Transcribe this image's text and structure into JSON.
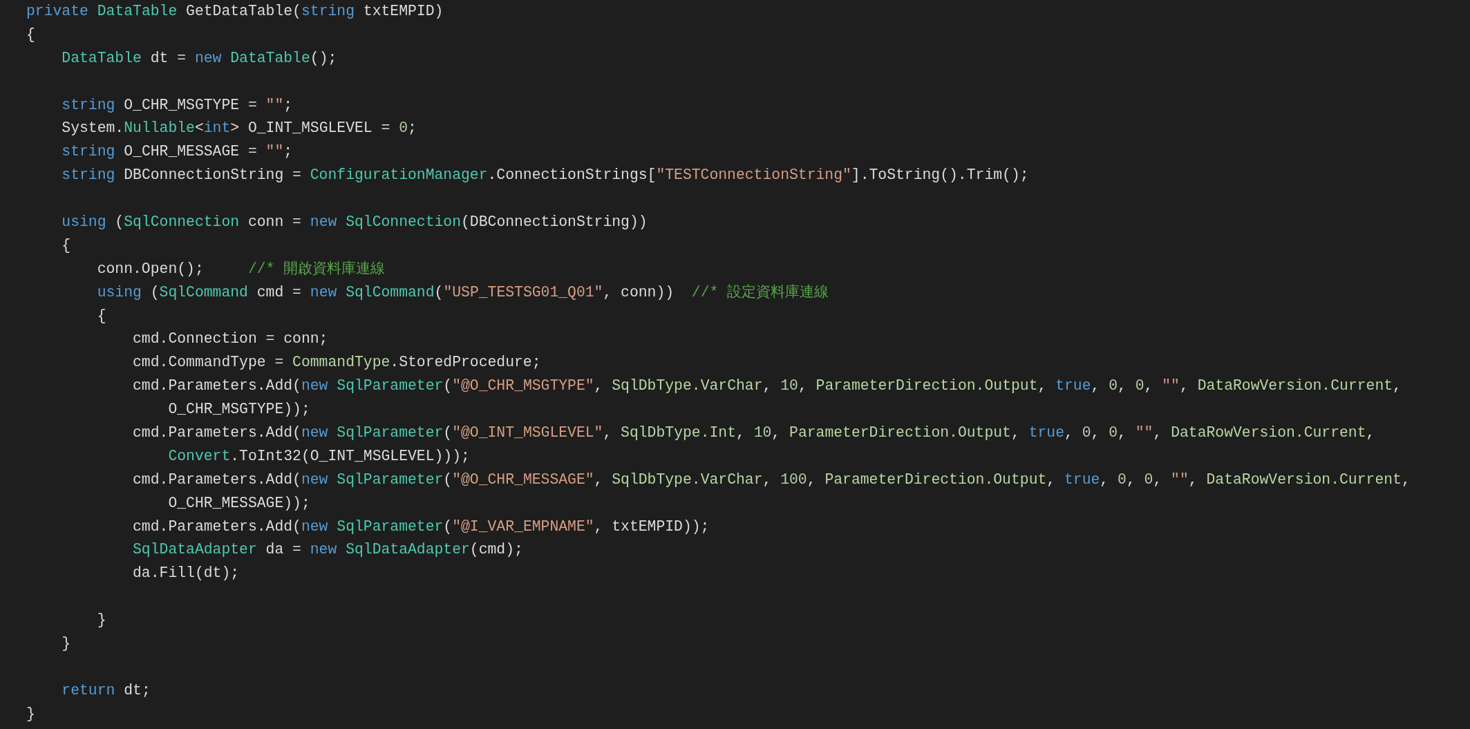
{
  "editor": {
    "lines": [
      {
        "kind": "code",
        "tokens": [
          {
            "kind": "keyword",
            "text": "private "
          },
          {
            "kind": "type",
            "text": "DataTable"
          },
          {
            "kind": "plain",
            "text": " GetDataTable("
          },
          {
            "kind": "keyword",
            "text": "string"
          },
          {
            "kind": "plain",
            "text": " txtEMPID)"
          }
        ]
      },
      {
        "kind": "code",
        "tokens": [
          {
            "kind": "plain",
            "text": "{"
          }
        ]
      },
      {
        "kind": "code",
        "tokens": [
          {
            "kind": "type",
            "text": "    DataTable"
          },
          {
            "kind": "plain",
            "text": " dt = "
          },
          {
            "kind": "keyword",
            "text": "new "
          },
          {
            "kind": "type",
            "text": "DataTable"
          },
          {
            "kind": "plain",
            "text": "();"
          }
        ]
      },
      {
        "kind": "blank"
      },
      {
        "kind": "code",
        "tokens": [
          {
            "kind": "keyword",
            "text": "    string"
          },
          {
            "kind": "plain",
            "text": " O_CHR_MSGTYPE = "
          },
          {
            "kind": "string",
            "text": "\"\""
          },
          {
            "kind": "plain",
            "text": ";"
          }
        ]
      },
      {
        "kind": "code",
        "tokens": [
          {
            "kind": "plain",
            "text": "    System."
          },
          {
            "kind": "type",
            "text": "Nullable"
          },
          {
            "kind": "plain",
            "text": "<"
          },
          {
            "kind": "keyword",
            "text": "int"
          },
          {
            "kind": "plain",
            "text": "> O_INT_MSGLEVEL = "
          },
          {
            "kind": "number",
            "text": "0"
          },
          {
            "kind": "plain",
            "text": ";"
          }
        ]
      },
      {
        "kind": "code",
        "tokens": [
          {
            "kind": "keyword",
            "text": "    string"
          },
          {
            "kind": "plain",
            "text": " O_CHR_MESSAGE = "
          },
          {
            "kind": "string",
            "text": "\"\""
          },
          {
            "kind": "plain",
            "text": ";"
          }
        ]
      },
      {
        "kind": "code",
        "tokens": [
          {
            "kind": "keyword",
            "text": "    string"
          },
          {
            "kind": "plain",
            "text": " DBConnectionString = "
          },
          {
            "kind": "type",
            "text": "ConfigurationManager"
          },
          {
            "kind": "plain",
            "text": ".ConnectionStrings["
          },
          {
            "kind": "string",
            "text": "\"TESTConnectionString\""
          },
          {
            "kind": "plain",
            "text": "].ToString().Trim();"
          }
        ]
      },
      {
        "kind": "blank"
      },
      {
        "kind": "code",
        "tokens": [
          {
            "kind": "keyword",
            "text": "    using"
          },
          {
            "kind": "plain",
            "text": " ("
          },
          {
            "kind": "type",
            "text": "SqlConnection"
          },
          {
            "kind": "plain",
            "text": " conn = "
          },
          {
            "kind": "keyword",
            "text": "new "
          },
          {
            "kind": "type",
            "text": "SqlConnection"
          },
          {
            "kind": "plain",
            "text": "(DBConnectionString))"
          }
        ]
      },
      {
        "kind": "code",
        "tokens": [
          {
            "kind": "plain",
            "text": "    {"
          }
        ]
      },
      {
        "kind": "code",
        "tokens": [
          {
            "kind": "plain",
            "text": "        conn.Open();     "
          },
          {
            "kind": "comment",
            "text": "//* 開啟資料庫連線"
          }
        ]
      },
      {
        "kind": "code",
        "tokens": [
          {
            "kind": "keyword",
            "text": "        using"
          },
          {
            "kind": "plain",
            "text": " ("
          },
          {
            "kind": "type",
            "text": "SqlCommand"
          },
          {
            "kind": "plain",
            "text": " cmd = "
          },
          {
            "kind": "keyword",
            "text": "new "
          },
          {
            "kind": "type",
            "text": "SqlCommand"
          },
          {
            "kind": "plain",
            "text": "("
          },
          {
            "kind": "string",
            "text": "\"USP_TESTSG01_Q01\""
          },
          {
            "kind": "plain",
            "text": ", conn))  "
          },
          {
            "kind": "comment",
            "text": "//* 設定資料庫連線"
          }
        ]
      },
      {
        "kind": "code",
        "tokens": [
          {
            "kind": "plain",
            "text": "        {"
          }
        ]
      },
      {
        "kind": "code",
        "tokens": [
          {
            "kind": "plain",
            "text": "            cmd.Connection = conn;"
          }
        ]
      },
      {
        "kind": "code",
        "tokens": [
          {
            "kind": "plain",
            "text": "            cmd.CommandType = "
          },
          {
            "kind": "member",
            "text": "CommandType"
          },
          {
            "kind": "plain",
            "text": ".StoredProcedure;"
          }
        ]
      },
      {
        "kind": "code",
        "tokens": [
          {
            "kind": "plain",
            "text": "            cmd.Parameters.Add("
          },
          {
            "kind": "keyword",
            "text": "new "
          },
          {
            "kind": "type",
            "text": "SqlParameter"
          },
          {
            "kind": "plain",
            "text": "("
          },
          {
            "kind": "string",
            "text": "\"@O_CHR_MSGTYPE\""
          },
          {
            "kind": "plain",
            "text": ", "
          },
          {
            "kind": "member",
            "text": "SqlDbType.VarChar"
          },
          {
            "kind": "plain",
            "text": ", "
          },
          {
            "kind": "number",
            "text": "10"
          },
          {
            "kind": "plain",
            "text": ", "
          },
          {
            "kind": "member",
            "text": "ParameterDirection.Output"
          },
          {
            "kind": "plain",
            "text": ", "
          },
          {
            "kind": "keyword",
            "text": "true"
          },
          {
            "kind": "plain",
            "text": ", "
          },
          {
            "kind": "number",
            "text": "0"
          },
          {
            "kind": "plain",
            "text": ", "
          },
          {
            "kind": "number",
            "text": "0"
          },
          {
            "kind": "plain",
            "text": ", "
          },
          {
            "kind": "string",
            "text": "\"\""
          },
          {
            "kind": "plain",
            "text": ", "
          },
          {
            "kind": "member",
            "text": "DataRowVersion.Current"
          },
          {
            "kind": "plain",
            "text": ","
          }
        ]
      },
      {
        "kind": "code",
        "tokens": [
          {
            "kind": "plain",
            "text": "                O_CHR_MSGTYPE));"
          }
        ]
      },
      {
        "kind": "code",
        "tokens": [
          {
            "kind": "plain",
            "text": "            cmd.Parameters.Add("
          },
          {
            "kind": "keyword",
            "text": "new "
          },
          {
            "kind": "type",
            "text": "SqlParameter"
          },
          {
            "kind": "plain",
            "text": "("
          },
          {
            "kind": "string",
            "text": "\"@O_INT_MSGLEVEL\""
          },
          {
            "kind": "plain",
            "text": ", "
          },
          {
            "kind": "member",
            "text": "SqlDbType.Int"
          },
          {
            "kind": "plain",
            "text": ", "
          },
          {
            "kind": "number",
            "text": "10"
          },
          {
            "kind": "plain",
            "text": ", "
          },
          {
            "kind": "member",
            "text": "ParameterDirection.Output"
          },
          {
            "kind": "plain",
            "text": ", "
          },
          {
            "kind": "keyword",
            "text": "true"
          },
          {
            "kind": "plain",
            "text": ", "
          },
          {
            "kind": "number",
            "text": "0"
          },
          {
            "kind": "plain",
            "text": ", "
          },
          {
            "kind": "number",
            "text": "0"
          },
          {
            "kind": "plain",
            "text": ", "
          },
          {
            "kind": "string",
            "text": "\"\""
          },
          {
            "kind": "plain",
            "text": ", "
          },
          {
            "kind": "member",
            "text": "DataRowVersion.Current"
          },
          {
            "kind": "plain",
            "text": ","
          }
        ]
      },
      {
        "kind": "code",
        "tokens": [
          {
            "kind": "type",
            "text": "                Convert"
          },
          {
            "kind": "plain",
            "text": ".ToInt32(O_INT_MSGLEVEL)));"
          }
        ]
      },
      {
        "kind": "code",
        "tokens": [
          {
            "kind": "plain",
            "text": "            cmd.Parameters.Add("
          },
          {
            "kind": "keyword",
            "text": "new "
          },
          {
            "kind": "type",
            "text": "SqlParameter"
          },
          {
            "kind": "plain",
            "text": "("
          },
          {
            "kind": "string",
            "text": "\"@O_CHR_MESSAGE\""
          },
          {
            "kind": "plain",
            "text": ", "
          },
          {
            "kind": "member",
            "text": "SqlDbType.VarChar"
          },
          {
            "kind": "plain",
            "text": ", "
          },
          {
            "kind": "number",
            "text": "100"
          },
          {
            "kind": "plain",
            "text": ", "
          },
          {
            "kind": "member",
            "text": "ParameterDirection.Output"
          },
          {
            "kind": "plain",
            "text": ", "
          },
          {
            "kind": "keyword",
            "text": "true"
          },
          {
            "kind": "plain",
            "text": ", "
          },
          {
            "kind": "number",
            "text": "0"
          },
          {
            "kind": "plain",
            "text": ", "
          },
          {
            "kind": "number",
            "text": "0"
          },
          {
            "kind": "plain",
            "text": ", "
          },
          {
            "kind": "string",
            "text": "\"\""
          },
          {
            "kind": "plain",
            "text": ", "
          },
          {
            "kind": "member",
            "text": "DataRowVersion.Current"
          },
          {
            "kind": "plain",
            "text": ","
          }
        ]
      },
      {
        "kind": "code",
        "tokens": [
          {
            "kind": "plain",
            "text": "                O_CHR_MESSAGE));"
          }
        ]
      },
      {
        "kind": "code",
        "tokens": [
          {
            "kind": "plain",
            "text": "            cmd.Parameters.Add("
          },
          {
            "kind": "keyword",
            "text": "new "
          },
          {
            "kind": "type",
            "text": "SqlParameter"
          },
          {
            "kind": "plain",
            "text": "("
          },
          {
            "kind": "string",
            "text": "\"@I_VAR_EMPNAME\""
          },
          {
            "kind": "plain",
            "text": ", txtEMPID));"
          }
        ]
      },
      {
        "kind": "code",
        "tokens": [
          {
            "kind": "type",
            "text": "            SqlDataAdapter"
          },
          {
            "kind": "plain",
            "text": " da = "
          },
          {
            "kind": "keyword",
            "text": "new "
          },
          {
            "kind": "type",
            "text": "SqlDataAdapter"
          },
          {
            "kind": "plain",
            "text": "(cmd);"
          }
        ]
      },
      {
        "kind": "code",
        "tokens": [
          {
            "kind": "plain",
            "text": "            da.Fill(dt);"
          }
        ]
      },
      {
        "kind": "blank"
      },
      {
        "kind": "code",
        "tokens": [
          {
            "kind": "plain",
            "text": "        }"
          }
        ]
      },
      {
        "kind": "code",
        "tokens": [
          {
            "kind": "plain",
            "text": "    }"
          }
        ]
      },
      {
        "kind": "blank"
      },
      {
        "kind": "code",
        "tokens": [
          {
            "kind": "keyword",
            "text": "    return"
          },
          {
            "kind": "plain",
            "text": " dt;"
          }
        ]
      },
      {
        "kind": "code",
        "tokens": [
          {
            "kind": "plain",
            "text": "}"
          }
        ]
      }
    ]
  }
}
